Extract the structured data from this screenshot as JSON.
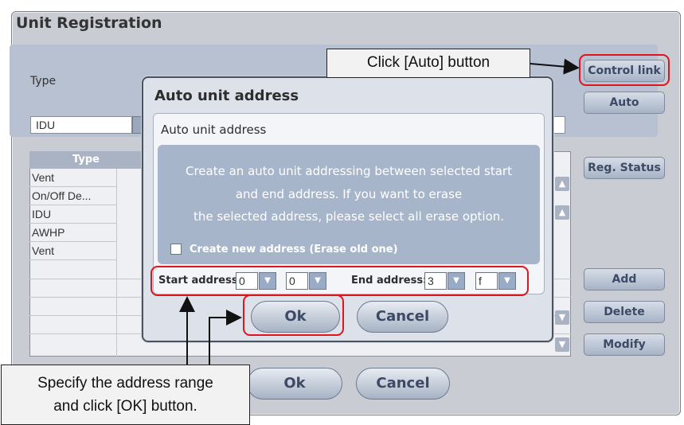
{
  "window": {
    "title": "Unit Registration"
  },
  "type_panel": {
    "type_label": "Type",
    "type_value": "IDU"
  },
  "grid": {
    "header": "Type",
    "rows": [
      "Vent",
      "On/Off De...",
      "IDU",
      "AWHP",
      "Vent"
    ]
  },
  "side_buttons": {
    "control_link": "Control link",
    "auto": "Auto",
    "reg_status": "Reg. Status",
    "add": "Add",
    "delete": "Delete",
    "modify": "Modify"
  },
  "main_buttons": {
    "ok": "Ok",
    "cancel": "Cancel"
  },
  "dialog": {
    "title": "Auto unit address",
    "subtitle": "Auto unit address",
    "info_lines": [
      "Create an auto unit addressing between selected start",
      "and end address. If you want to erase",
      "the selected address, please select all erase option."
    ],
    "erase_option": "Create new address (Erase old one)",
    "start_label": "Start address:",
    "start_values": [
      "0",
      "0"
    ],
    "end_label": "End address:",
    "end_values": [
      "3",
      "f"
    ],
    "ok": "Ok",
    "cancel": "Cancel"
  },
  "annotations": {
    "auto_callout": "Click [Auto] button",
    "range_callout_line1": "Specify the address range",
    "range_callout_line2": "and click [OK] button.",
    "highlight_color": "#e0141e"
  },
  "icons": {
    "dropdown": "chevron-down-icon",
    "scroll_up": "scroll-up-icon",
    "scroll_down": "scroll-down-icon",
    "checkbox": "checkbox-icon"
  }
}
